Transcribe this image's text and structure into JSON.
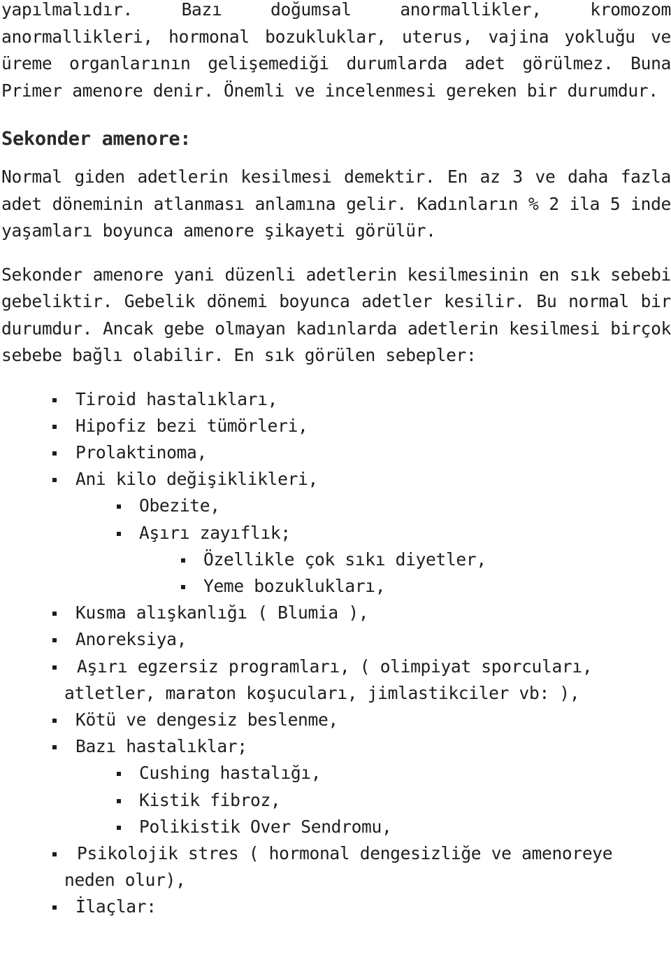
{
  "document": {
    "intro_paragraph": "yapılmalıdır. Bazı doğumsal anormallikler, kromozom anormallikleri, hormonal bozukluklar, uterus, vajina yokluğu ve üreme organlarının gelişemediği durumlarda adet görülmez. Buna Primer amenore denir. Önemli ve incelenmesi gereken bir durumdur.",
    "section_heading": "Sekonder amenore:",
    "definition_paragraph": "Normal giden adetlerin kesilmesi demektir. En az 3 ve daha fazla adet döneminin atlanması anlamına gelir. Kadınların % 2 ila 5 inde yaşamları boyunca amenore şikayeti görülür.",
    "causes_paragraph": "Sekonder amenore yani düzenli adetlerin kesilmesinin en sık sebebi gebeliktir. Gebelik dönemi boyunca adetler kesilir. Bu normal bir durumdur. Ancak gebe olmayan kadınlarda adetlerin kesilmesi birçok sebebe bağlı olabilir. En sık görülen sebepler:",
    "causes_list": [
      {
        "level": 0,
        "text": "Tiroid hastalıkları,"
      },
      {
        "level": 0,
        "text": "Hipofiz bezi tümörleri,"
      },
      {
        "level": 0,
        "text": "Prolaktinoma,"
      },
      {
        "level": 0,
        "text": "Ani kilo değişiklikleri,"
      },
      {
        "level": 1,
        "text": "Obezite,"
      },
      {
        "level": 1,
        "text": "Aşırı zayıflık;"
      },
      {
        "level": 2,
        "text": "Özellikle çok sıkı diyetler,"
      },
      {
        "level": 2,
        "text": "Yeme bozuklukları,"
      },
      {
        "level": 0,
        "text": "Kusma alışkanlığı ( Blumia ),"
      },
      {
        "level": 0,
        "text": "Anoreksiya,"
      },
      {
        "level": 0,
        "text": "Aşırı egzersiz programları, ( olimpiyat sporcuları,",
        "continuation": "atletler, maraton koşucuları, jimlastikciler vb: ),"
      },
      {
        "level": 0,
        "text": "Kötü ve dengesiz beslenme,"
      },
      {
        "level": 0,
        "text": "Bazı hastalıklar;"
      },
      {
        "level": 1,
        "text": "Cushing hastalığı,"
      },
      {
        "level": 1,
        "text": "Kistik fibroz,"
      },
      {
        "level": 1,
        "text": "Polikistik Over Sendromu,"
      },
      {
        "level": 0,
        "text": "Psikolojik stres ( hormonal dengesizliğe ve amenoreye",
        "continuation": "neden olur),"
      },
      {
        "level": 0,
        "text": "İlaçlar:"
      }
    ]
  }
}
